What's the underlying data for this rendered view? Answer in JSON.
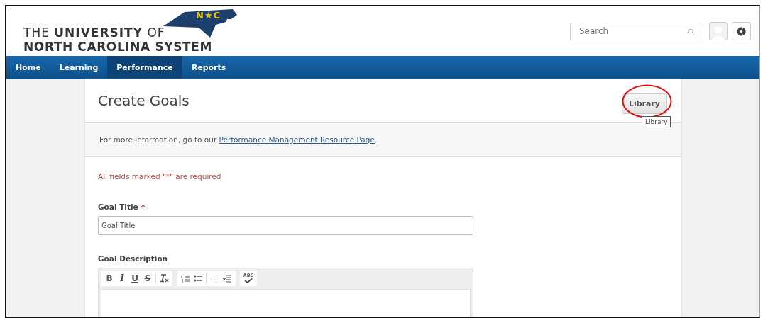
{
  "logo": {
    "line_1": "THE **UNIVERSITY** OF",
    "line_2": "NORTH CAROLINA SYSTEM",
    "badge": "N★C"
  },
  "search": {
    "placeholder": "Search"
  },
  "nav": [
    {
      "label": "Home",
      "selected": false
    },
    {
      "label": "Learning",
      "selected": false
    },
    {
      "label": "Performance",
      "selected": true
    },
    {
      "label": "Reports",
      "selected": false
    }
  ],
  "page": {
    "title": "Create Goals",
    "library_button": "Library",
    "tooltip": "Library",
    "info": "For more information, go to our ",
    "info_link": "Performance Management Resource Page",
    "info_end": "."
  },
  "form": {
    "required_note": "All fields marked \"*\" are required",
    "fields": [
      {
        "label": "Goal Title",
        "required_mark": "*",
        "kind": "input",
        "placeholder": "Goal Title"
      },
      {
        "label": "Goal Description",
        "kind": "editor"
      }
    ],
    "toolbar": [
      [
        {
          "kind": "bold",
          "label": "B",
          "disabled": false
        },
        {
          "kind": "italic",
          "label": "I",
          "disabled": false
        },
        {
          "kind": "underline",
          "label": "U",
          "disabled": false
        },
        {
          "kind": "strike",
          "label": "S",
          "disabled": false
        },
        {
          "kind": "clear-format",
          "disabled": false
        }
      ],
      [
        {
          "kind": "numbered-list",
          "disabled": false
        },
        {
          "kind": "bullet-list",
          "disabled": false
        },
        {
          "kind": "outdent",
          "disabled": true
        },
        {
          "kind": "indent",
          "disabled": false
        }
      ],
      [
        {
          "kind": "spellcheck",
          "label": "ABC",
          "disabled": false
        }
      ]
    ]
  }
}
